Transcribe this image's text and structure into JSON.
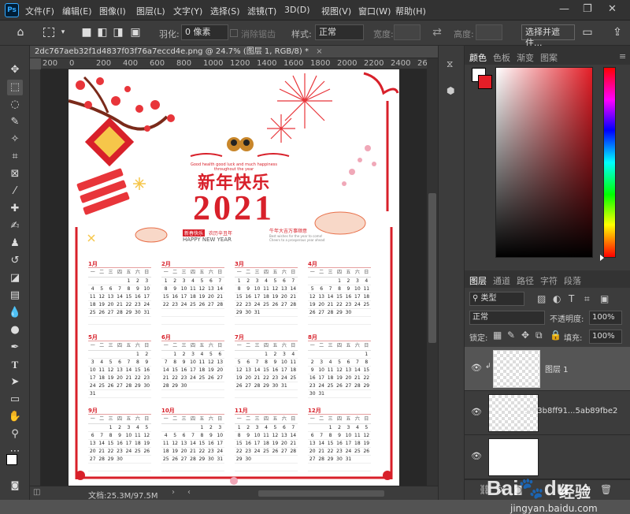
{
  "menubar": {
    "logo": "Ps",
    "items": [
      "文件(F)",
      "编辑(E)",
      "图像(I)",
      "图层(L)",
      "文字(Y)",
      "选择(S)",
      "滤镜(T)",
      "3D(D)",
      "视图(V)",
      "窗口(W)",
      "帮助(H)"
    ],
    "minimize": "—",
    "restore": "❐",
    "close": "✕"
  },
  "options": {
    "feather_label": "羽化:",
    "feather_value": "0 像素",
    "antialias_label": "消除锯齿",
    "style_label": "样式:",
    "style_value": "正常",
    "width_label": "宽度:",
    "height_label": "高度:",
    "select_mask_label": "选择并遮住..."
  },
  "document": {
    "tab_title": "2dc767aeb32f1d4837f03f76a7eccd4e.png @ 24.7% (图层 1, RGB/8) *",
    "ruler_top": [
      "200",
      "0",
      "200",
      "400",
      "600",
      "800",
      "1000",
      "1200",
      "1400",
      "1600",
      "1800",
      "2000",
      "2200",
      "2400",
      "2600"
    ],
    "status": "文档:25.3M/97.5M"
  },
  "poster": {
    "greeting_en": "Good health good luck and much happiness throughout the year",
    "title": "新年快乐",
    "year": "2021",
    "tag": "新春快乐",
    "sub_cn": "农历辛丑年",
    "happy": "HAPPY NEW YEAR",
    "right_cn": "牛年大吉万事顺意",
    "right_en": "Best wishes for the year to come! Cheers to a prosperous year ahead",
    "weekdays": [
      "一",
      "二",
      "三",
      "四",
      "五",
      "六",
      "日"
    ],
    "months": [
      {
        "name": "1月",
        "offset": 4,
        "days": 31
      },
      {
        "name": "2月",
        "offset": 0,
        "days": 28
      },
      {
        "name": "3月",
        "offset": 0,
        "days": 31
      },
      {
        "name": "4月",
        "offset": 3,
        "days": 30
      },
      {
        "name": "5月",
        "offset": 5,
        "days": 31
      },
      {
        "name": "6月",
        "offset": 1,
        "days": 30
      },
      {
        "name": "7月",
        "offset": 3,
        "days": 31
      },
      {
        "name": "8月",
        "offset": 6,
        "days": 31
      },
      {
        "name": "9月",
        "offset": 2,
        "days": 30
      },
      {
        "name": "10月",
        "offset": 4,
        "days": 31
      },
      {
        "name": "11月",
        "offset": 0,
        "days": 30
      },
      {
        "name": "12月",
        "offset": 2,
        "days": 31
      }
    ]
  },
  "panel": {
    "tabs": [
      "颜色",
      "色板",
      "渐变",
      "图案"
    ],
    "layer_tabs": [
      "图层",
      "通道",
      "路径",
      "字符",
      "段落"
    ],
    "kind": "类型",
    "blend": "正常",
    "opacity_label": "不透明度:",
    "opacity": "100%",
    "lock_label": "锁定:",
    "fill_label": "填充:",
    "fill": "100%",
    "layers": [
      {
        "name": "图层 1"
      },
      {
        "name": "5f83b8ff91...5ab89fbe2"
      },
      {
        "name": ""
      }
    ]
  },
  "watermark": {
    "logo": "Bai",
    "logo2": "du",
    "site": "经验",
    "url": "jingyan.baidu.com"
  },
  "colors": {
    "accent": "#e41e27",
    "fg": "#ffffff",
    "bg": "#e41e27"
  }
}
